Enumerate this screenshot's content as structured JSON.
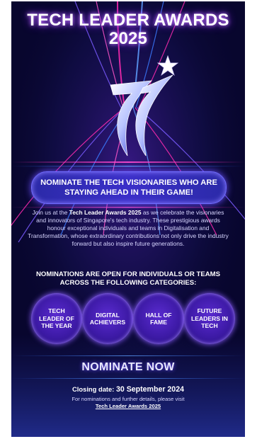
{
  "title": {
    "line1": "TECH LEADER AWARDS",
    "line2": "2025"
  },
  "banner": {
    "text": "NOMINATE THE TECH VISIONARIES WHO ARE STAYING AHEAD IN THEIR GAME!"
  },
  "intro": {
    "before": "Join us at the ",
    "bold": "Tech Leader Awards 2025",
    "after": " as we celebrate the visionaries and innovators of Singapore's tech industry. These prestigious awards honour exceptional individuals and teams in Digitalisation and Transformation, whose extraordinary contributions not only drive the industry forward but also inspire future generations."
  },
  "categories": {
    "heading": "NOMINATIONS ARE OPEN FOR INDIVIDUALS OR TEAMS ACROSS THE FOLLOWING CATEGORIES:",
    "items": [
      {
        "label": "TECH LEADER OF THE YEAR"
      },
      {
        "label": "DIGITAL ACHIEVERS"
      },
      {
        "label": "HALL OF FAME"
      },
      {
        "label": "FUTURE LEADERS IN TECH"
      }
    ]
  },
  "cta": {
    "label": "NOMINATE NOW"
  },
  "closing": {
    "prefix": "Closing date: ",
    "date": "30 September 2024"
  },
  "details": {
    "text": "For nominations and further details, please visit",
    "link_label": "Tech Leader Awards 2025"
  },
  "colors": {
    "background": "#08062e",
    "accent_blue": "#3b2fc9",
    "accent_purple": "#5a2bd0",
    "glow_pink": "#ff2bb0"
  },
  "icons": {
    "star": "star-icon",
    "seven_logo": "seven-swoosh-icon"
  }
}
